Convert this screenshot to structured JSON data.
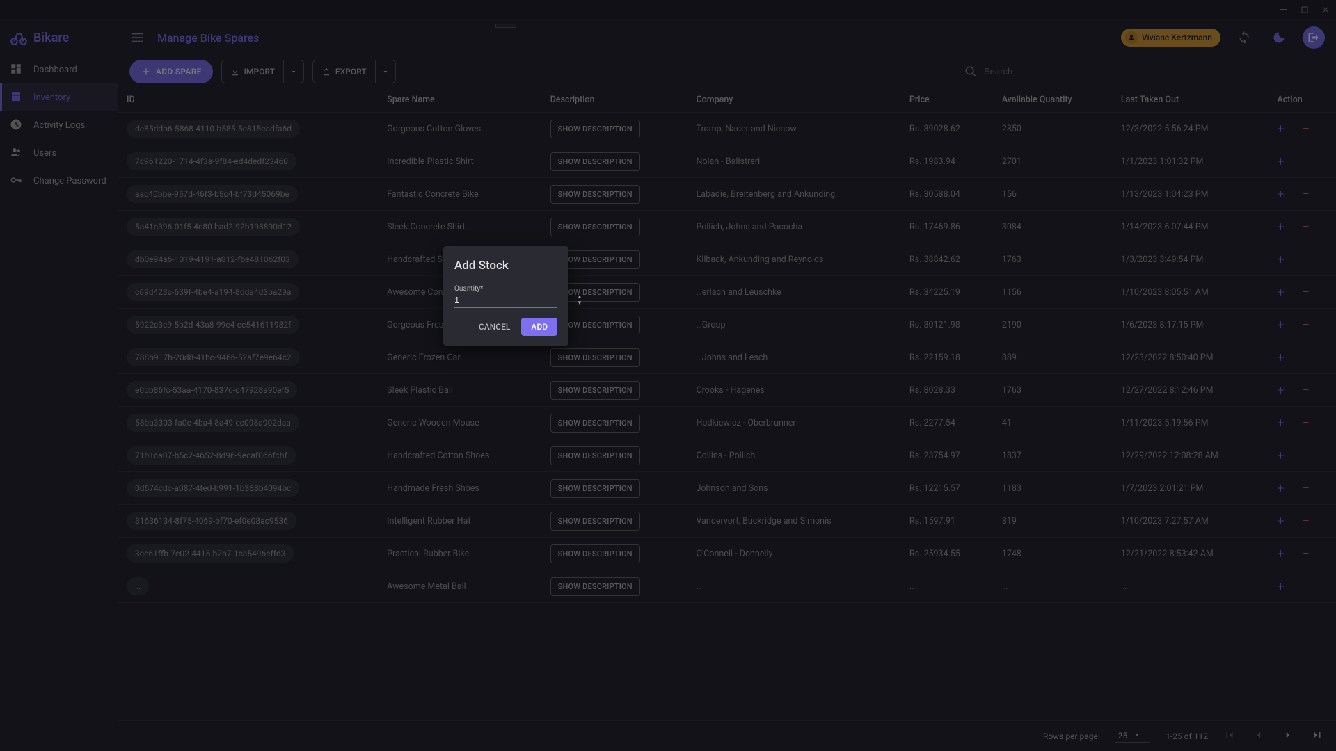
{
  "app_name": "Bikare",
  "page_title": "Manage Bike Spares",
  "user_name": "Viviane Kertzmann",
  "sidebar": {
    "items": [
      {
        "label": "Dashboard",
        "icon": "dashboard-icon",
        "active": false
      },
      {
        "label": "Inventory",
        "icon": "inventory-icon",
        "active": true
      },
      {
        "label": "Activity Logs",
        "icon": "clock-icon",
        "active": false
      },
      {
        "label": "Users",
        "icon": "users-icon",
        "active": false
      },
      {
        "label": "Change Password",
        "icon": "key-icon",
        "active": false
      }
    ]
  },
  "toolbar": {
    "add_label": "ADD SPARE",
    "import_label": "IMPORT",
    "export_label": "EXPORT",
    "search_placeholder": "Search"
  },
  "columns": [
    "ID",
    "Spare Name",
    "Description",
    "Company",
    "Price",
    "Available Quantity",
    "Last Taken Out",
    "Action"
  ],
  "desc_btn_label": "SHOW DESCRIPTION",
  "rows": [
    {
      "id": "de85ddb6-5868-4110-b585-5e815eadfa6d",
      "name": "Gorgeous Cotton Gloves",
      "company": "Tromp, Nader and Nienow",
      "price": "Rs. 39028.62",
      "qty": "2850",
      "last": "12/3/2022 5:56:24 PM"
    },
    {
      "id": "7c961220-1714-4f3a-9f84-ed4dedf23460",
      "name": "Incredible Plastic Shirt",
      "company": "Nolan - Balistreri",
      "price": "Rs. 1983.94",
      "qty": "2701",
      "last": "1/1/2023 1:01:32 PM"
    },
    {
      "id": "aac40bbe-957d-46f3-b5c4-bf73d45069be",
      "name": "Fantastic Concrete Bike",
      "company": "Labadie, Breitenberg and Ankunding",
      "price": "Rs. 30588.04",
      "qty": "156",
      "last": "1/13/2023 1:04:23 PM"
    },
    {
      "id": "5a41c396-01f5-4c80-bad2-92b198890d12",
      "name": "Sleek Concrete Shirt",
      "company": "Pollich, Johns and Pacocha",
      "price": "Rs. 17469.86",
      "qty": "3084",
      "last": "1/14/2023 6:07:44 PM"
    },
    {
      "id": "db0e94a6-1019-4191-a012-fbe481062f03",
      "name": "Handcrafted Steel Ball",
      "company": "Kilback, Ankunding and Reynolds",
      "price": "Rs. 38842.62",
      "qty": "1763",
      "last": "1/3/2023 3:49:54 PM"
    },
    {
      "id": "c69d423c-639f-4be4-a194-8dda4d3ba29a",
      "name": "Awesome Concrete Bike",
      "company": "…erlach and Leuschke",
      "price": "Rs. 34225.19",
      "qty": "1156",
      "last": "1/10/2023 8:05:51 AM"
    },
    {
      "id": "5922c3e9-5b2d-43a8-99e4-ee541611982f",
      "name": "Gorgeous Fresh Ball",
      "company": "…Group",
      "price": "Rs. 30121.98",
      "qty": "2190",
      "last": "1/6/2023 8:17:15 PM"
    },
    {
      "id": "788b917b-20d8-41bc-9466-52af7e9e64c2",
      "name": "Generic Frozen Car",
      "company": "…Johns and Lesch",
      "price": "Rs. 22159.18",
      "qty": "889",
      "last": "12/23/2022 8:50:40 PM"
    },
    {
      "id": "e0bb86fc-53aa-4170-837d-c47928a90ef5",
      "name": "Sleek Plastic Ball",
      "company": "Crooks - Hagenes",
      "price": "Rs. 8028.33",
      "qty": "1763",
      "last": "12/27/2022 8:12:46 PM"
    },
    {
      "id": "58ba3303-fa0e-4ba4-8a49-ec098a902daa",
      "name": "Generic Wooden Mouse",
      "company": "Hodkiewicz - Oberbrunner",
      "price": "Rs. 2277.54",
      "qty": "41",
      "last": "1/11/2023 5:19:56 PM"
    },
    {
      "id": "71b1ca07-b5c2-4652-8d96-9ecaf066fcbf",
      "name": "Handcrafted Cotton Shoes",
      "company": "Collins - Pollich",
      "price": "Rs. 23754.97",
      "qty": "1837",
      "last": "12/29/2022 12:08:28 AM"
    },
    {
      "id": "0d674cdc-a087-4fed-b991-1b388b4094bc",
      "name": "Handmade Fresh Shoes",
      "company": "Johnson and Sons",
      "price": "Rs. 12215.57",
      "qty": "1183",
      "last": "1/7/2023 2:01:21 PM"
    },
    {
      "id": "31636134-8f75-4069-bf70-ef0e08ac9536",
      "name": "Intelligent Rubber Hat",
      "company": "Vandervort, Buckridge and Simonis",
      "price": "Rs. 1597.91",
      "qty": "819",
      "last": "1/10/2023 7:27:57 AM"
    },
    {
      "id": "3ce61ffb-7e02-4415-b2b7-1ca5496effd3",
      "name": "Practical Rubber Bike",
      "company": "O'Connell - Donnelly",
      "price": "Rs. 25934.55",
      "qty": "1748",
      "last": "12/21/2022 8:53:42 AM"
    },
    {
      "id": "…",
      "name": "Awesome Metal Ball",
      "company": "…",
      "price": "…",
      "qty": "…",
      "last": "…"
    }
  ],
  "pagination": {
    "rows_label": "Rows per page:",
    "rows_value": "25",
    "range_text": "1-25 of 112"
  },
  "modal": {
    "title": "Add Stock",
    "field_label": "Quantity*",
    "value": "1",
    "cancel": "CANCEL",
    "add": "ADD"
  }
}
